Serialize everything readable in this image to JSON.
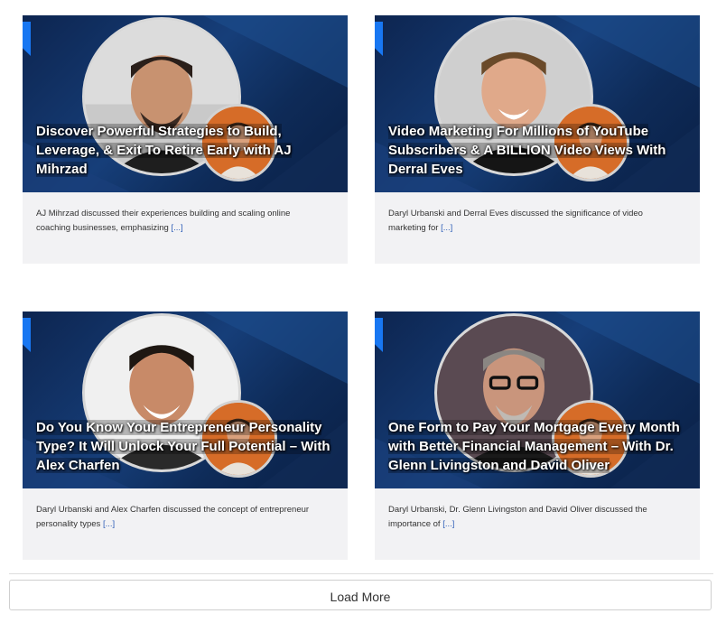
{
  "posts": [
    {
      "title": "Discover Powerful Strategies to Build, Leverage, & Exit To Retire Early with AJ Mihrzad",
      "excerpt": "AJ Mihrzad discussed their experiences building and scaling online coaching businesses, emphasizing",
      "more": "[...]"
    },
    {
      "title": "Video Marketing For Millions of YouTube Subscribers & A BILLION Video Views With Derral Eves",
      "excerpt": "Daryl Urbanski and Derral Eves discussed the significance of video marketing for",
      "more": "[...]"
    },
    {
      "title": "Do You Know Your Entrepreneur Personality Type? It Will Unlock Your Full Potential – With Alex Charfen",
      "excerpt": "Daryl Urbanski and Alex Charfen discussed the concept of entrepreneur personality types",
      "more": "[...]"
    },
    {
      "title": "One Form to Pay Your Mortgage Every Month with Better Financial Management – With Dr. Glenn Livingston and David Oliver",
      "excerpt": "Daryl Urbanski, Dr. Glenn Livingston and David Oliver discussed the importance of",
      "more": "[...]"
    }
  ],
  "load_more_label": "Load More",
  "colors": {
    "accent_flag": "#1877f2",
    "thumb_bg": "#0d2550",
    "card_bg": "#f2f2f4",
    "link": "#2f5fb8"
  }
}
